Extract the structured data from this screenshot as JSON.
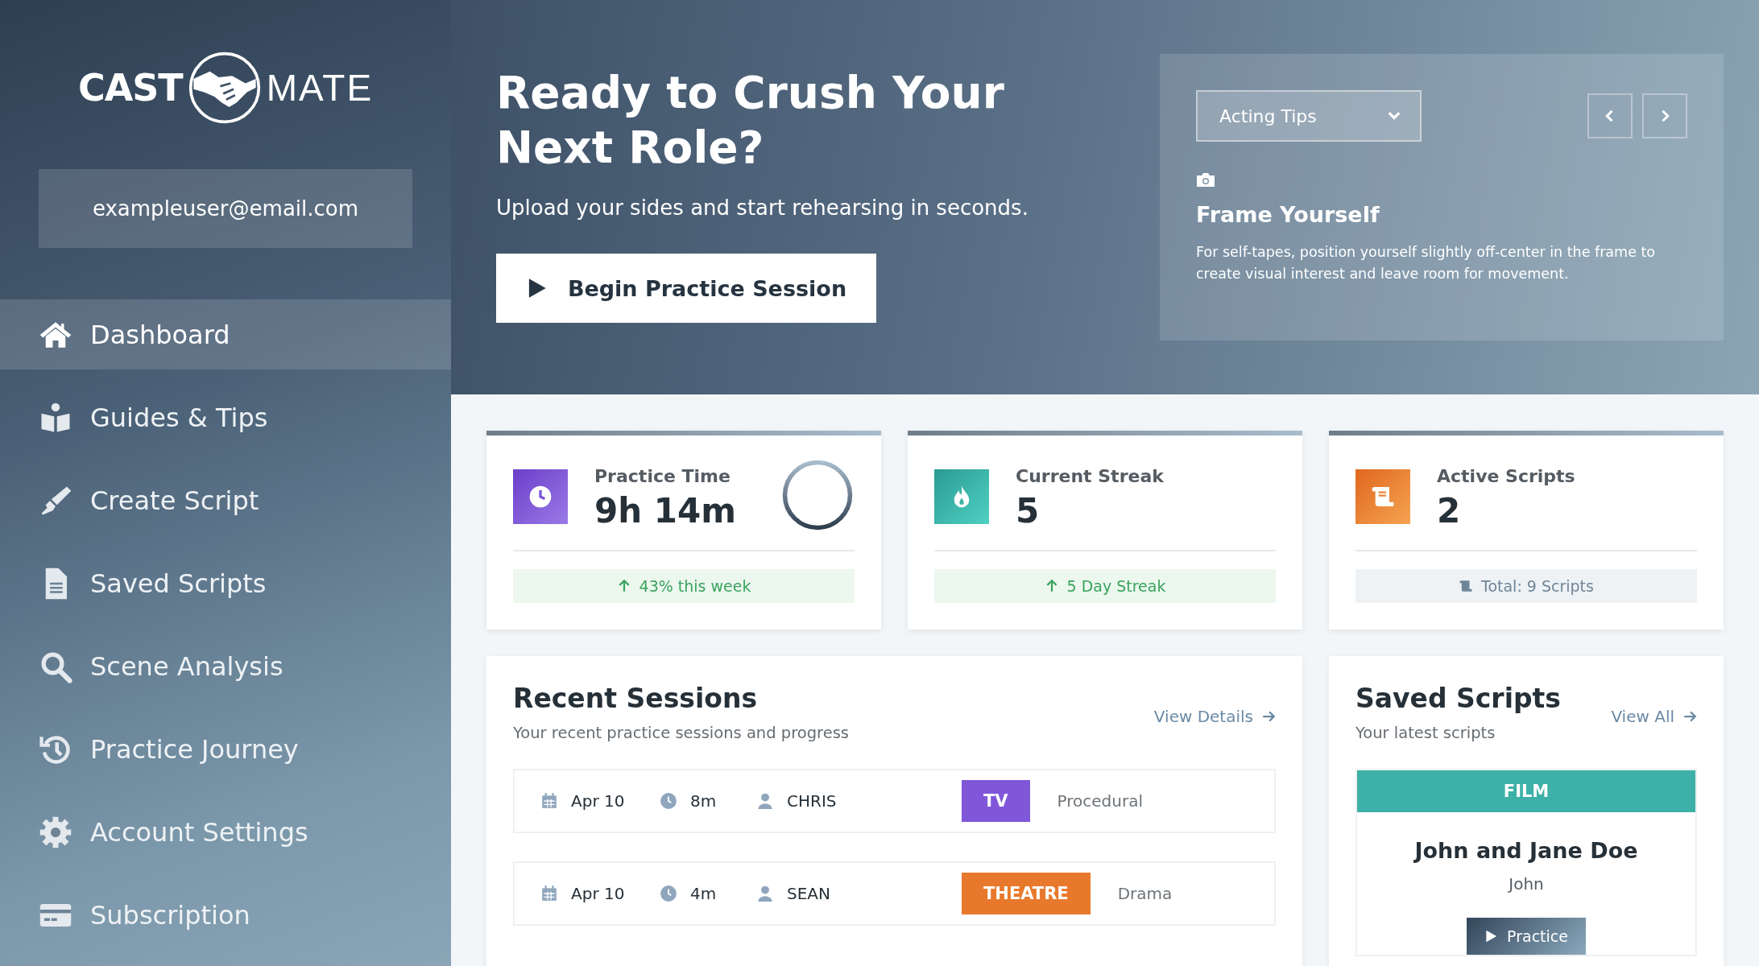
{
  "logo": {
    "bold": "CAST",
    "light": "MATE"
  },
  "user_email": "exampleuser@email.com",
  "nav": [
    {
      "label": "Dashboard",
      "selected": true
    },
    {
      "label": "Guides & Tips",
      "selected": false
    },
    {
      "label": "Create Script",
      "selected": false
    },
    {
      "label": "Saved Scripts",
      "selected": false
    },
    {
      "label": "Scene Analysis",
      "selected": false
    },
    {
      "label": "Practice Journey",
      "selected": false
    },
    {
      "label": "Account Settings",
      "selected": false
    },
    {
      "label": "Subscription",
      "selected": false
    }
  ],
  "hero": {
    "title": "Ready to Crush Your Next Role?",
    "subtitle": "Upload your sides and start rehearsing in seconds.",
    "button": "Begin Practice Session"
  },
  "tips": {
    "dropdown": "Acting Tips",
    "title": "Frame Yourself",
    "body": "For self-tapes, position yourself slightly off-center in the frame to create visual interest and leave room for movement."
  },
  "stats": [
    {
      "label": "Practice Time",
      "value": "9h 14m",
      "note": "43% this week",
      "kind": "up"
    },
    {
      "label": "Current Streak",
      "value": "5",
      "note": "5 Day Streak",
      "kind": "up"
    },
    {
      "label": "Active Scripts",
      "value": "2",
      "note": "Total: 9 Scripts",
      "kind": "total"
    }
  ],
  "recent_sessions": {
    "title": "Recent Sessions",
    "subtitle": "Your recent practice sessions and progress",
    "link": "View Details",
    "rows": [
      {
        "date": "Apr 10",
        "duration": "8m",
        "name": "CHRIS",
        "tag": "TV",
        "color": "#8057d9",
        "genre": "Procedural"
      },
      {
        "date": "Apr 10",
        "duration": "4m",
        "name": "SEAN",
        "tag": "THEATRE",
        "color": "#e8792c",
        "genre": "Drama"
      }
    ]
  },
  "saved_scripts": {
    "title": "Saved Scripts",
    "subtitle": "Your latest scripts",
    "link": "View All",
    "scripts": [
      {
        "category": "FILM",
        "title": "John and Jane Doe",
        "role": "John",
        "button": "Practice"
      }
    ]
  }
}
